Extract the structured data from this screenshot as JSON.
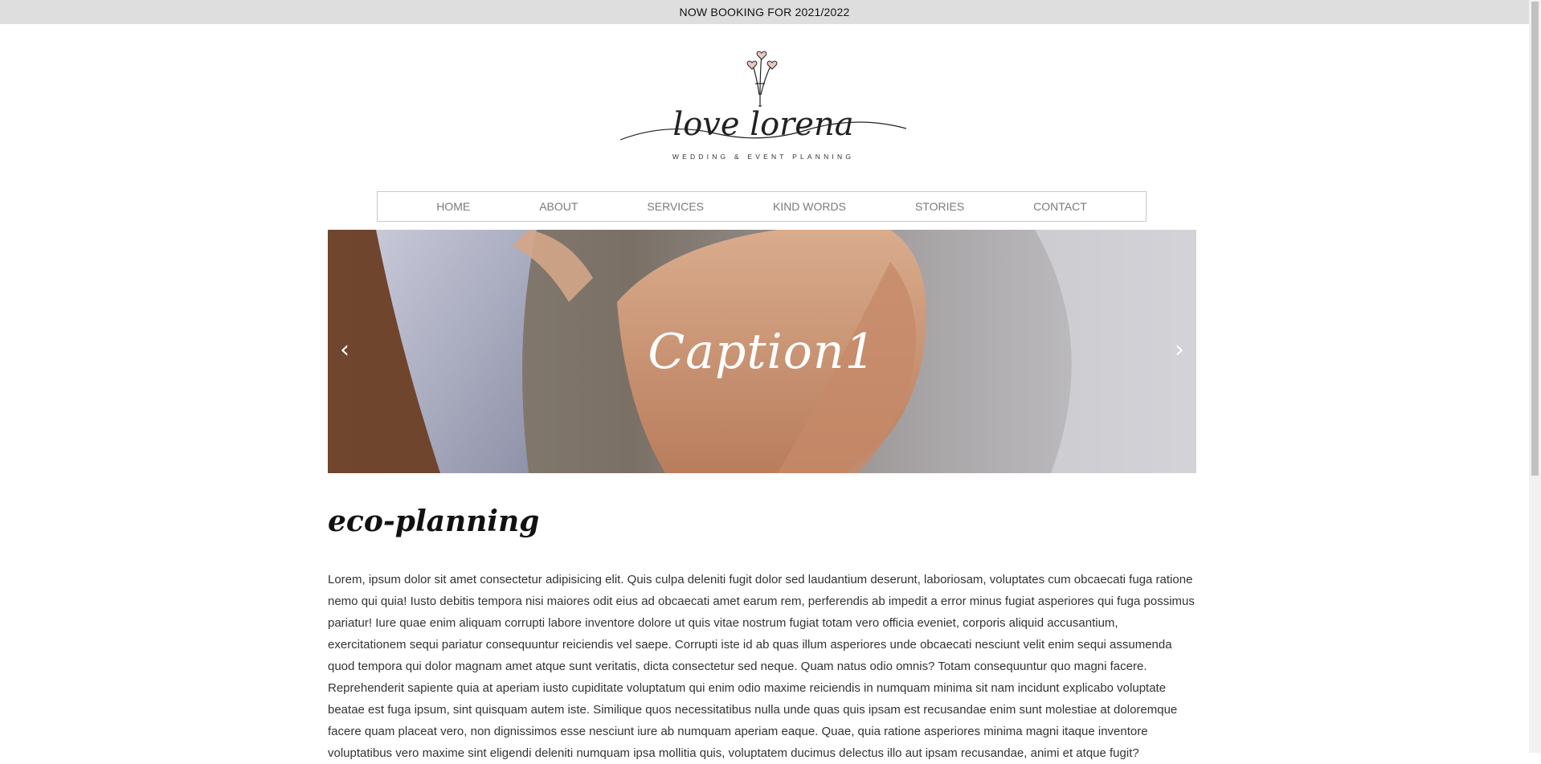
{
  "announcement": {
    "text": "NOW BOOKING FOR 2021/2022"
  },
  "logo": {
    "brand_script": "love lorena",
    "tagline": "WEDDING & EVENT PLANNING"
  },
  "nav": {
    "items": [
      {
        "label": "HOME"
      },
      {
        "label": "ABOUT"
      },
      {
        "label": "SERVICES"
      },
      {
        "label": "KIND WORDS"
      },
      {
        "label": "STORIES"
      },
      {
        "label": "CONTACT"
      }
    ]
  },
  "hero": {
    "caption": "Caption1",
    "prev_label": "‹",
    "next_label": "›"
  },
  "section": {
    "title": "eco-planning",
    "body": "Lorem, ipsum dolor sit amet consectetur adipisicing elit. Quis culpa deleniti fugit dolor sed laudantium deserunt, laboriosam, voluptates cum obcaecati fuga ratione nemo qui quia! Iusto debitis tempora nisi maiores odit eius ad obcaecati amet earum rem, perferendis ab impedit a error minus fugiat asperiores qui fuga possimus pariatur! Iure quae enim aliquam corrupti labore inventore dolore ut quis vitae nostrum fugiat totam vero officia eveniet, corporis aliquid accusantium, exercitationem sequi pariatur consequuntur reiciendis vel saepe. Corrupti iste id ab quas illum asperiores unde obcaecati nesciunt velit enim sequi assumenda quod tempora qui dolor magnam amet atque sunt veritatis, dicta consectetur sed neque. Quam natus odio omnis? Totam consequuntur quo magni facere. Reprehenderit sapiente quia at aperiam iusto cupiditate voluptatum qui enim odio maxime reiciendis in numquam minima sit nam incidunt explicabo voluptate beatae est fuga ipsum, sint quisquam autem iste. Similique quos necessitatibus nulla unde quas quis ipsam est recusandae enim sunt molestiae at doloremque facere quam placeat vero, non dignissimos esse nesciunt iure ab numquam aperiam eaque. Quae, quia ratione asperiores minima magni itaque inventore voluptatibus vero maxime sint eligendi deleniti numquam ipsa mollitia quis, voluptatem ducimus delectus illo aut ipsam recusandae, animi et atque fugit?"
  },
  "colors": {
    "announcement_bg": "#dedede",
    "nav_text": "#7a7a7a",
    "nav_border": "#c9c9c9",
    "body_text": "#333333"
  }
}
